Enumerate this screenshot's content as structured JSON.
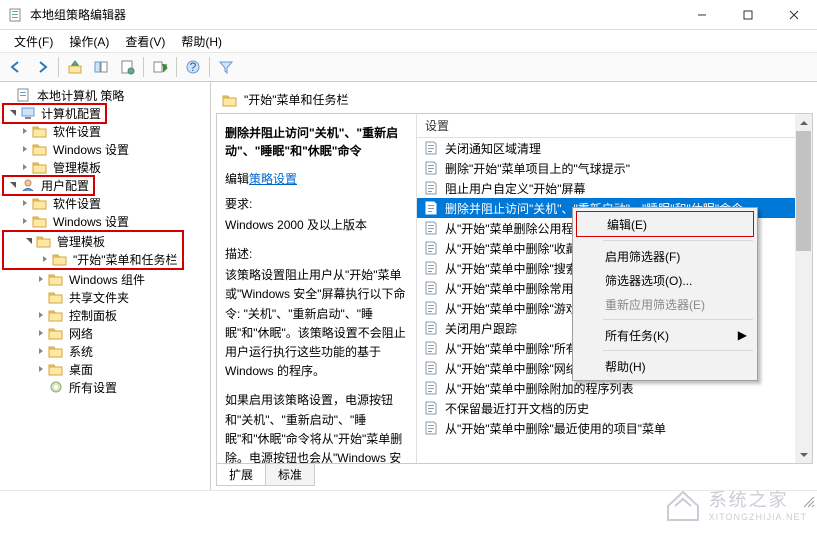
{
  "window": {
    "title": "本地组策略编辑器",
    "min": "—",
    "max": "☐",
    "close": "✕"
  },
  "menu": {
    "file": "文件(F)",
    "action": "操作(A)",
    "view": "查看(V)",
    "help": "帮助(H)"
  },
  "tree": {
    "root": "本地计算机 策略",
    "cconf": "计算机配置",
    "cconf_children": [
      "软件设置",
      "Windows 设置",
      "管理模板"
    ],
    "uconf": "用户配置",
    "uconf_children": [
      "软件设置",
      "Windows 设置",
      "管理模板"
    ],
    "at_children_sel": "\"开始\"菜单和任务栏",
    "at_children": [
      "Windows 组件",
      "共享文件夹",
      "控制面板",
      "网络",
      "系统",
      "桌面",
      "所有设置"
    ]
  },
  "header": {
    "title": "\"开始\"菜单和任务栏"
  },
  "desc": {
    "title": "删除并阻止访问\"关机\"、\"重新启动\"、\"睡眠\"和\"休眠\"命令",
    "edit_prefix": "编辑",
    "edit_link": "策略设置",
    "req_label": "要求:",
    "req_text": "Windows 2000 及以上版本",
    "desc_label": "描述:",
    "desc_text": "该策略设置阻止用户从\"开始\"菜单或\"Windows 安全\"屏幕执行以下命令: \"关机\"、\"重新启动\"、\"睡眠\"和\"休眠\"。该策略设置不会阻止用户运行执行这些功能的基于Windows 的程序。",
    "desc_text2": "如果启用该策略设置，电源按钮和\"关机\"、\"重新启动\"、\"睡眠\"和\"休眠\"命令将从\"开始\"菜单删除。电源按钮也会从\"Windows 安全\"屏幕删除，该屏幕在按"
  },
  "list": {
    "header": "设置",
    "items": [
      "关闭通知区域清理",
      "删除\"开始\"菜单项目上的\"气球提示\"",
      "阻止用户自定义\"开始\"屏幕",
      "删除并阻止访问\"关机\"、\"重新启动\"、\"睡眠\"和\"休眠\"命令",
      "从\"开始\"菜单删除公用程序组",
      "从\"开始\"菜单中删除\"收藏夹\"菜单",
      "从\"开始\"菜单中删除\"搜索\"链接",
      "从\"开始\"菜单中删除常用程序列表",
      "从\"开始\"菜单中删除\"游戏\"链接",
      "关闭用户跟踪",
      "从\"开始\"菜单中删除\"所有程序\"列表",
      "从\"开始\"菜单中删除\"网络连接\"",
      "从\"开始\"菜单中删除附加的程序列表",
      "不保留最近打开文档的历史",
      "从\"开始\"菜单中删除\"最近使用的项目\"菜单"
    ],
    "selected_index": 3
  },
  "ctx": {
    "edit": "编辑(E)",
    "filter_on": "启用筛选器(F)",
    "filter_opt": "筛选器选项(O)...",
    "reapply": "重新应用筛选器(E)",
    "all_tasks": "所有任务(K)",
    "help": "帮助(H)"
  },
  "tabs": {
    "ext": "扩展",
    "std": "标准"
  },
  "watermark": {
    "main": "系统之家",
    "sub": "XITONGZHIJIA.NET"
  }
}
